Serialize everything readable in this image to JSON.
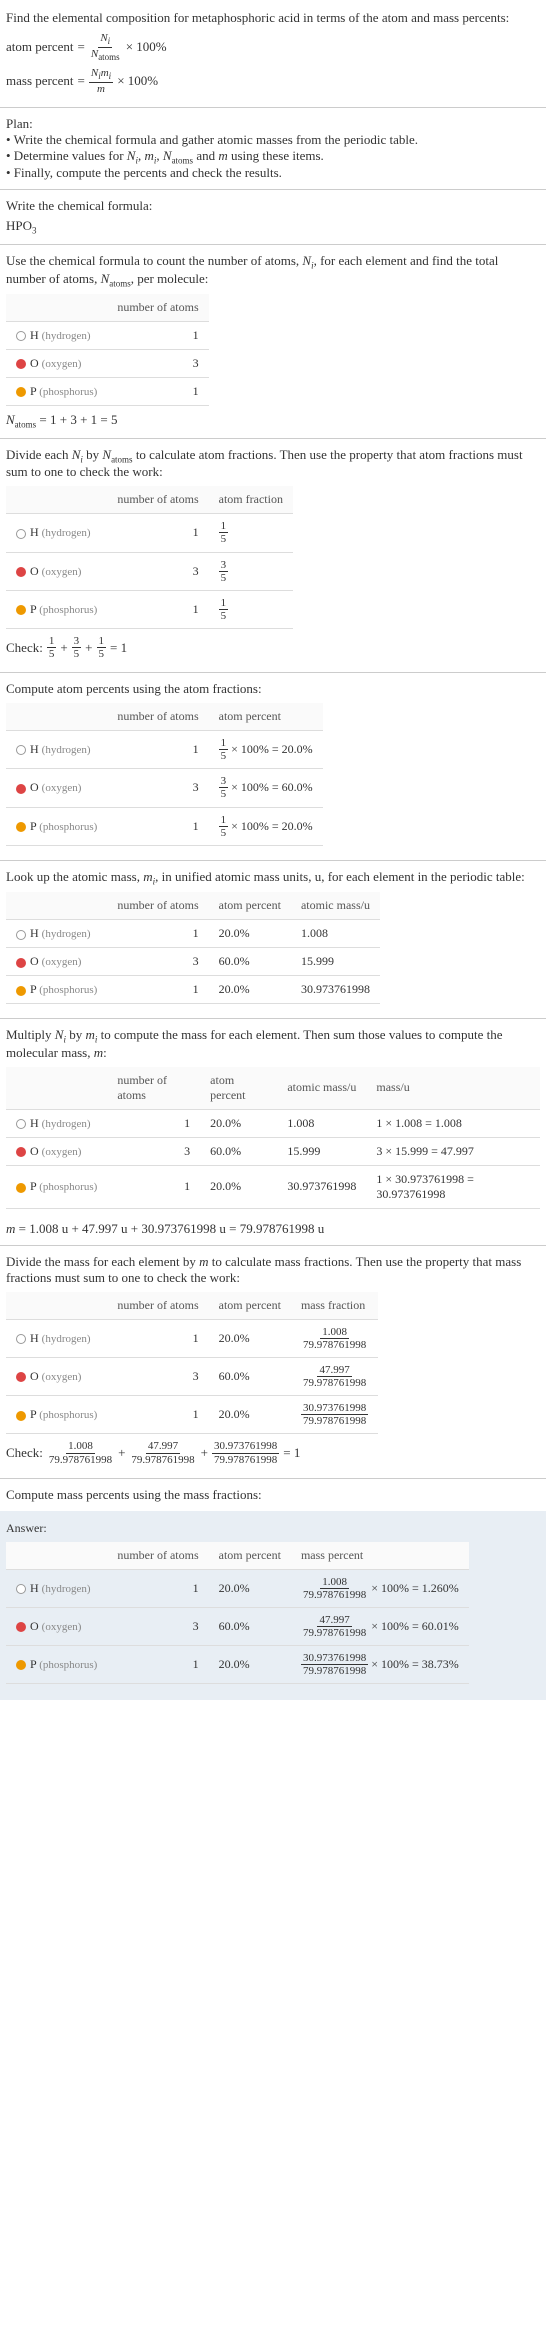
{
  "problem": {
    "intro": "Find the elemental composition for metaphosphoric acid in terms of the atom and mass percents:",
    "atom_percent_label": "atom percent",
    "mass_percent_label": "mass percent",
    "eq": "=",
    "times100": "× 100%",
    "N_i": "N",
    "N_i_sub": "i",
    "N_atoms": "N",
    "N_atoms_sub": "atoms",
    "Nimi_num": "N_i m_i",
    "m": "m"
  },
  "plan": {
    "title": "Plan:",
    "b1": "• Write the chemical formula and gather atomic masses from the periodic table.",
    "b2_a": "• Determine values for ",
    "b2_b": " using these items.",
    "vars": "N_i, m_i, N_atoms and m",
    "b3": "• Finally, compute the percents and check the results."
  },
  "formula_section": {
    "heading": "Write the chemical formula:",
    "formula_text": "HPO",
    "formula_sub": "3"
  },
  "count_section": {
    "text_a": "Use the chemical formula to count the number of atoms, ",
    "text_b": ", for each element and find the total number of atoms, ",
    "text_c": ", per molecule:",
    "Ni_label": "N_i",
    "Natoms_label": "N_atoms",
    "headers": {
      "atoms": "number of atoms"
    },
    "sum_line": " = 1 + 3 + 1 = 5"
  },
  "elements": [
    {
      "sym": "H",
      "name": "hydrogen",
      "swatch": "h",
      "count": "1"
    },
    {
      "sym": "O",
      "name": "oxygen",
      "swatch": "o",
      "count": "3"
    },
    {
      "sym": "P",
      "name": "phosphorus",
      "swatch": "p",
      "count": "1"
    }
  ],
  "atom_frac": {
    "intro_a": "Divide each ",
    "intro_b": " by ",
    "intro_c": " to calculate atom fractions. Then use the property that atom fractions must sum to one to check the work:",
    "header_atomfrac": "atom fraction",
    "fracs": [
      {
        "num": "1",
        "den": "5"
      },
      {
        "num": "3",
        "den": "5"
      },
      {
        "num": "1",
        "den": "5"
      }
    ],
    "check_label": "Check: ",
    "check_eq": " = 1",
    "plus": " + "
  },
  "atom_pct": {
    "intro": "Compute atom percents using the atom fractions:",
    "header_atompct": "atom percent",
    "rows": [
      {
        "num": "1",
        "den": "5",
        "res": " × 100% = 20.0%"
      },
      {
        "num": "3",
        "den": "5",
        "res": " × 100% = 60.0%"
      },
      {
        "num": "1",
        "den": "5",
        "res": " × 100% = 20.0%"
      }
    ]
  },
  "atomic_mass": {
    "intro_a": "Look up the atomic mass, ",
    "intro_b": ", in unified atomic mass units, u, for each element in the periodic table:",
    "mi_label": "m_i",
    "header_mass": "atomic mass/u",
    "pct": [
      "20.0%",
      "60.0%",
      "20.0%"
    ],
    "mass": [
      "1.008",
      "15.999",
      "30.973761998"
    ]
  },
  "mol_mass": {
    "intro_a": "Multiply ",
    "intro_b": " by ",
    "intro_c": " to compute the mass for each element. Then sum those values to compute the molecular mass, ",
    "intro_d": ":",
    "header_massu": "mass/u",
    "mass_rows": [
      "1 × 1.008 = 1.008",
      "3 × 15.999 = 47.997",
      "1 × 30.973761998 = 30.973761998"
    ],
    "sum_label": "m",
    "sum_eq": " = 1.008 u + 47.997 u + 30.973761998 u = 79.978761998 u"
  },
  "mass_frac": {
    "intro_a": "Divide the mass for each element by ",
    "intro_b": " to calculate mass fractions. Then use the property that mass fractions must sum to one to check the work:",
    "header_massfrac": "mass fraction",
    "fracs": [
      {
        "num": "1.008",
        "den": "79.978761998"
      },
      {
        "num": "47.997",
        "den": "79.978761998"
      },
      {
        "num": "30.973761998",
        "den": "79.978761998"
      }
    ],
    "check_label": "Check: ",
    "check_eq": " = 1"
  },
  "mass_pct": {
    "intro": "Compute mass percents using the mass fractions:"
  },
  "answer": {
    "label": "Answer:",
    "header_masspct": "mass percent",
    "rows": [
      {
        "pct": "20.0%",
        "num": "1.008",
        "den": "79.978761998",
        "res": "× 100% = 1.260%"
      },
      {
        "pct": "60.0%",
        "num": "47.997",
        "den": "79.978761998",
        "res": "× 100% = 60.01%"
      },
      {
        "pct": "20.0%",
        "num": "30.973761998",
        "den": "79.978761998",
        "res": "× 100% = 38.73%"
      }
    ]
  }
}
